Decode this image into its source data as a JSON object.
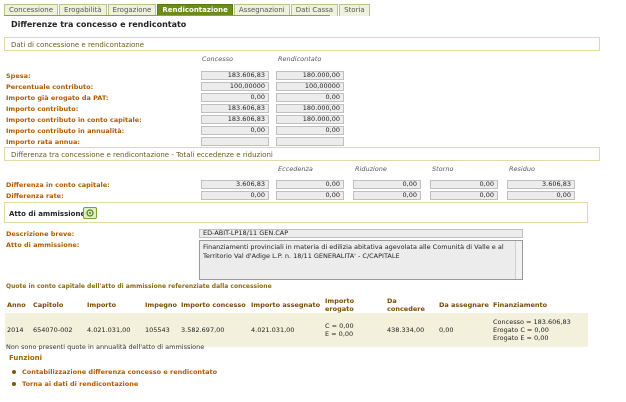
{
  "tabs": [
    {
      "label": "Concessione",
      "active": false
    },
    {
      "label": "Erogabilità",
      "active": false
    },
    {
      "label": "Erogazione",
      "active": false
    },
    {
      "label": "Rendicontazione",
      "active": true
    },
    {
      "label": "Assegnazioni",
      "active": false
    },
    {
      "label": "Dati Cassa",
      "active": false
    },
    {
      "label": "Storia",
      "active": false
    }
  ],
  "page_title": "Differenze tra concesso e rendicontato",
  "section1": {
    "title": "Dati di concessione e rendicontazione",
    "col_concesso": "Concesso",
    "col_rendicontato": "Rendicontato",
    "rows": [
      {
        "label": "Spesa:",
        "concesso": "183.606,83",
        "rendicontato": "180.000,00"
      },
      {
        "label": "Percentuale contributo:",
        "concesso": "100,00000",
        "rendicontato": "100,00000"
      },
      {
        "label": "Importo già erogato da PAT:",
        "concesso": "0,00",
        "rendicontato": "0,00"
      },
      {
        "label": "Importo contributo:",
        "concesso": "183.606,83",
        "rendicontato": "180.000,00"
      },
      {
        "label": "Importo contributo in conto capitale:",
        "concesso": "183.606,83",
        "rendicontato": "180.000,00"
      },
      {
        "label": "Importo contributo in annualità:",
        "concesso": "0,00",
        "rendicontato": "0,00"
      },
      {
        "label": "Importo rata annua:",
        "concesso": "",
        "rendicontato": ""
      }
    ]
  },
  "section2": {
    "title": "Differenza tra concessione e rendicontazione - Totali eccedenze e riduzioni",
    "col_eccedenza": "Eccedenza",
    "col_riduzione": "Riduzione",
    "col_storno": "Storno",
    "col_residuo": "Residuo",
    "rows": [
      {
        "label": "Differenza in conto capitale:",
        "diff": "3.606,83",
        "eccedenza": "0,00",
        "riduzione": "0,00",
        "storno": "0,00",
        "residuo": "3.606,83"
      },
      {
        "label": "Differenza rate:",
        "diff": "0,00",
        "eccedenza": "0,00",
        "riduzione": "0,00",
        "storno": "0,00",
        "residuo": "0,00"
      }
    ]
  },
  "atto": {
    "title": "Atto di ammissione",
    "descrizione_label": "Descrizione breve:",
    "descrizione_value": "ED-ABIT-LP18/11 GEN.CAP",
    "atto_label": "Atto di ammissione:",
    "atto_value": "Finanziamenti provinciali in materia di edilizia abitativa agevolata alle Comunità di Valle e al Territorio Val d'Adige L.P. n. 18/11 GENERALITA' - C/CAPITALE"
  },
  "quote": {
    "title": "Quote in conto capitale dell'atto di ammissione referenziate dalla concessione",
    "headers": [
      "Anno",
      "Capitolo",
      "Importo",
      "Impegno",
      "Importo concesso",
      "Importo assegnato",
      "Importo erogato",
      "Da concedere",
      "Da assegnare",
      "Finanziamento"
    ],
    "row": {
      "anno": "2014",
      "capitolo": "654070-002",
      "importo": "4.021.031,00",
      "impegno": "105543",
      "concesso": "3.582.697,00",
      "assegnato": "4.021.031,00",
      "erogato_c": "C = 0,00",
      "erogato_e": "E = 0,00",
      "da_concedere": "438.334,00",
      "da_assegnare": "0,00",
      "fin_1": "Concesso = 183.606,83",
      "fin_2": "Erogato C = 0,00",
      "fin_3": "Erogato E = 0,00"
    }
  },
  "note": "Non sono presenti quote in annualità dell'atto di ammissione",
  "funzioni": {
    "title": "Funzioni",
    "links": [
      "Contabilizzazione differenza concesso e rendicontato",
      "Torna ai dati di rendicontazione"
    ]
  }
}
